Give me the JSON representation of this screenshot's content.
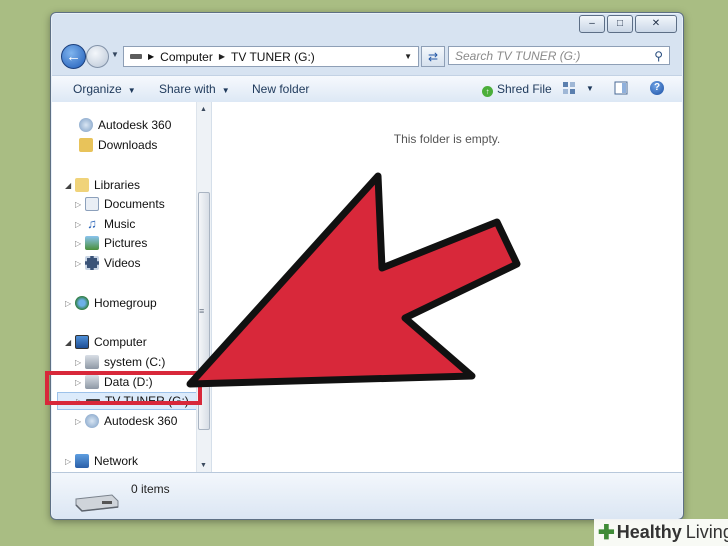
{
  "window": {
    "minimize": "–",
    "maximize": "□",
    "close": "✕"
  },
  "address": {
    "computer": "Computer",
    "drive": "TV TUNER (G:)"
  },
  "search": {
    "placeholder": "Search TV TUNER (G:)"
  },
  "toolbar": {
    "organize": "Organize",
    "share_with": "Share with",
    "new_folder": "New folder",
    "shred_file": "Shred File"
  },
  "sidebar": {
    "items": [
      {
        "label": "Autodesk 360",
        "icon": "cloud-icon"
      },
      {
        "label": "Downloads",
        "icon": "downloads-folder-icon"
      },
      {
        "label": "Libraries",
        "icon": "libraries-icon"
      },
      {
        "label": "Documents",
        "icon": "documents-icon"
      },
      {
        "label": "Music",
        "icon": "music-icon"
      },
      {
        "label": "Pictures",
        "icon": "pictures-icon"
      },
      {
        "label": "Videos",
        "icon": "videos-icon"
      },
      {
        "label": "Homegroup",
        "icon": "homegroup-icon"
      },
      {
        "label": "Computer",
        "icon": "computer-icon"
      },
      {
        "label": "system (C:)",
        "icon": "hard-drive-icon"
      },
      {
        "label": "Data (D:)",
        "icon": "hard-drive-icon"
      },
      {
        "label": "TV TUNER (G:)",
        "icon": "removable-drive-icon"
      },
      {
        "label": "Autodesk 360",
        "icon": "cloud-icon"
      },
      {
        "label": "Network",
        "icon": "network-icon"
      }
    ]
  },
  "content": {
    "empty_message": "This folder is empty."
  },
  "status": {
    "item_count": "0 items"
  },
  "watermark": {
    "brand_bold": "Healthy",
    "brand_light": "Living"
  },
  "colors": {
    "highlight": "#d8283a",
    "arrow": "#d8283a"
  }
}
